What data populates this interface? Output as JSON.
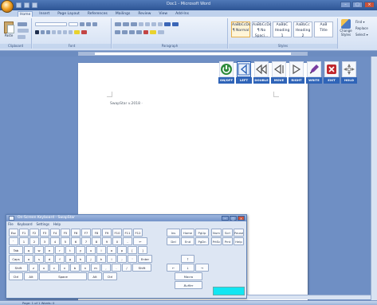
{
  "window": {
    "title": "Doc1 - Microsoft Word",
    "controls": [
      "–",
      "□",
      "×"
    ]
  },
  "tabs": [
    "Home",
    "Insert",
    "Page Layout",
    "References",
    "Mailings",
    "Review",
    "View",
    "Add-Ins"
  ],
  "ribbon": {
    "groups": [
      "Clipboard",
      "Font",
      "Paragraph",
      "Styles",
      "Editing"
    ],
    "paste_label": "Paste",
    "styles": [
      {
        "preview": "AaBbCcDc",
        "name": "¶ Normal"
      },
      {
        "preview": "AaBbCcDc",
        "name": "¶ No Spaci..."
      },
      {
        "preview": "AaBbC",
        "name": "Heading 1"
      },
      {
        "preview": "AaBbCc",
        "name": "Heading 2"
      },
      {
        "preview": "AaB",
        "name": "Title"
      },
      {
        "preview": "AaBbCcI",
        "name": "Subtitle"
      }
    ],
    "change_styles_label": "Change Styles",
    "editing": [
      "Find ▾",
      "Replace",
      "Select ▾"
    ]
  },
  "document": {
    "text": "SwapStar v.2018 ·"
  },
  "floating_toolbar": [
    {
      "label": "ON/OFF",
      "color": "#2e8b3a",
      "icon": "power-icon"
    },
    {
      "label": "LEFT",
      "color": "#3b7fbf",
      "icon": "left-arrow-icon"
    },
    {
      "label": "DOUBLE",
      "color": "#666",
      "icon": "double-left-icon"
    },
    {
      "label": "MOVE",
      "color": "#666",
      "icon": "move-left-icon"
    },
    {
      "label": "RIGHT",
      "color": "#666",
      "icon": "right-arrow-icon"
    },
    {
      "label": "WRITE",
      "color": "#7a3ca0",
      "icon": "pen-icon"
    },
    {
      "label": "EXIT",
      "color": "#c0282e",
      "icon": "exit-icon"
    },
    {
      "label": "HOLD",
      "color": "#666",
      "icon": "hold-icon"
    }
  ],
  "osk": {
    "title": "On-Screen Keyboard - SwapStar",
    "menu": [
      "File",
      "Keyboard",
      "Settings",
      "Help"
    ],
    "rows": [
      [
        "Esc",
        "F1",
        "F2",
        "F3",
        "F4",
        "F5",
        "F6",
        "F7",
        "F8",
        "F9",
        "F10",
        "F11",
        "F12"
      ],
      [
        "`",
        "1",
        "2",
        "3",
        "4",
        "5",
        "6",
        "7",
        "8",
        "9",
        "0",
        "-",
        "←"
      ],
      [
        "Tab",
        "q",
        "w",
        "e",
        "r",
        "t",
        "y",
        "u",
        "i",
        "o",
        "p",
        "[",
        "]"
      ],
      [
        "Caps",
        "a",
        "s",
        "d",
        "f",
        "g",
        "h",
        "j",
        "k",
        "l",
        ";",
        "'",
        "Enter"
      ],
      [
        "Shift",
        "z",
        "x",
        "c",
        "v",
        "b",
        "n",
        "m",
        ",",
        ".",
        "/",
        "Shift"
      ],
      [
        "Ctrl",
        "Alt",
        "Space",
        "Alt",
        "Ctrl"
      ]
    ],
    "nav": [
      "Ins",
      "Home",
      "PgUp",
      "Del",
      "End",
      "PgDn",
      "↑",
      "←",
      "↓",
      "→",
      "Macro",
      "Buffer"
    ],
    "side": [
      "Num",
      "Scrl",
      "Pause",
      "PrtSc",
      "Prnt",
      "Help"
    ]
  },
  "status": {
    "text": "Page: 1 of 1   Words: 0"
  }
}
